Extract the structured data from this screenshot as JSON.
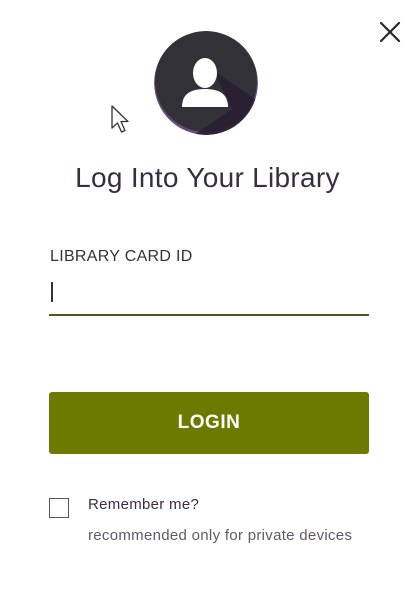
{
  "dialog": {
    "title": "Log Into Your Library",
    "close_icon": "close-icon",
    "avatar_icon": "user-silhouette-icon"
  },
  "card_field": {
    "label": "LIBRARY CARD ID",
    "value": "",
    "placeholder": ""
  },
  "login_button": {
    "label": "LOGIN"
  },
  "remember": {
    "label": "Remember me?",
    "note": "recommended only for private devices",
    "checked": false
  },
  "colors": {
    "accent": "#6d7a00",
    "underline": "#4e5a16",
    "text": "#3a2d42",
    "avatar_bg": "#2f2d35",
    "avatar_ring": "#6a4b7e"
  }
}
